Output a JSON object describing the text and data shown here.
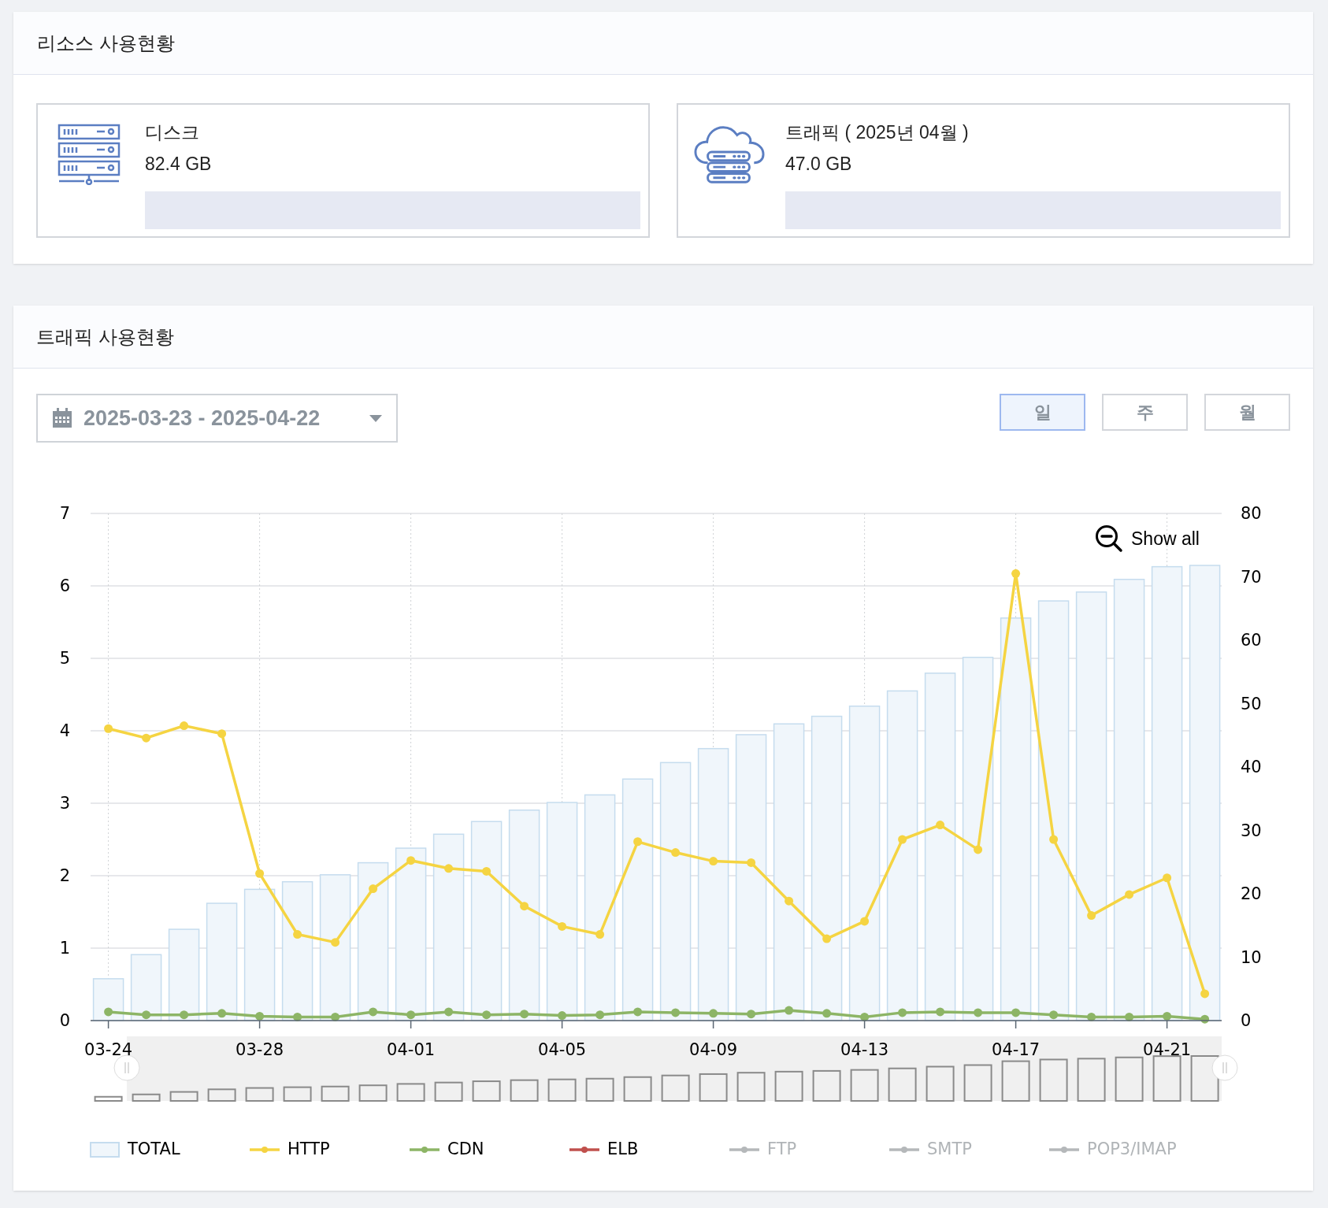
{
  "resources": {
    "title": "리소스 사용현황",
    "cards": [
      {
        "kind": "disk",
        "label": "디스크",
        "value": "82.4 GB",
        "level": 0
      },
      {
        "kind": "traffic",
        "label": "트래픽 ( 2025년 04월 )",
        "value": "47.0 GB",
        "level": 0
      }
    ]
  },
  "traffic": {
    "title": "트래픽 사용현황",
    "date_range": "2025-03-23 - 2025-04-22",
    "periods": [
      {
        "label": "일",
        "selected": true
      },
      {
        "label": "주",
        "selected": false
      },
      {
        "label": "월",
        "selected": false
      }
    ],
    "show_all": "Show all",
    "chart_data": {
      "type": "bar",
      "categories": [
        "03-24",
        null,
        null,
        null,
        "03-28",
        null,
        null,
        null,
        "04-01",
        null,
        null,
        null,
        "04-05",
        null,
        null,
        null,
        "04-09",
        null,
        null,
        null,
        "04-13",
        null,
        null,
        null,
        "04-17",
        null,
        null,
        null,
        "04-21",
        null
      ],
      "series": [
        {
          "name": "TOTAL",
          "type": "bar",
          "axis": "y2",
          "color": "#c5dcee",
          "values": [
            6.6,
            10.4,
            14.4,
            18.5,
            20.7,
            21.9,
            23.0,
            24.9,
            27.2,
            29.4,
            31.4,
            33.2,
            34.4,
            35.6,
            38.1,
            40.7,
            42.9,
            45.1,
            46.8,
            48.0,
            49.6,
            52.0,
            54.8,
            57.3,
            63.5,
            66.2,
            67.6,
            69.6,
            71.6,
            71.8
          ]
        },
        {
          "name": "HTTP",
          "type": "line",
          "marker": true,
          "color": "#f5d442",
          "values": [
            4.03,
            3.9,
            4.07,
            3.96,
            2.03,
            1.19,
            1.08,
            1.82,
            2.21,
            2.1,
            2.06,
            1.58,
            1.3,
            1.19,
            2.47,
            2.32,
            2.2,
            2.18,
            1.65,
            1.13,
            1.37,
            2.5,
            2.7,
            2.36,
            6.17,
            2.5,
            1.45,
            1.74,
            1.97,
            0.37
          ]
        },
        {
          "name": "CDN",
          "type": "line",
          "marker": true,
          "color": "#8db566",
          "values": [
            0.12,
            0.08,
            0.08,
            0.1,
            0.06,
            0.05,
            0.05,
            0.12,
            0.08,
            0.12,
            0.08,
            0.09,
            0.07,
            0.08,
            0.12,
            0.11,
            0.1,
            0.09,
            0.14,
            0.1,
            0.05,
            0.11,
            0.12,
            0.11,
            0.11,
            0.08,
            0.05,
            0.05,
            0.06,
            0.02
          ]
        }
      ],
      "grid": true,
      "ylim": [
        0,
        7
      ],
      "yticks": [
        0,
        1,
        2,
        3,
        4,
        5,
        6,
        7
      ],
      "y2lim": [
        0,
        80
      ],
      "y2ticks": [
        0,
        10,
        20,
        30,
        40,
        50,
        60,
        70,
        80
      ]
    },
    "other_legend": [
      {
        "label": "ELB",
        "kind": "line",
        "color": "#c0504d",
        "visible": true
      },
      {
        "label": "FTP",
        "kind": "line",
        "color": "#b5b8ba",
        "visible": false
      },
      {
        "label": "SMTP",
        "kind": "line",
        "color": "#b5b8ba",
        "visible": false
      },
      {
        "label": "POP3/IMAP",
        "kind": "line",
        "color": "#b5b8ba",
        "visible": false
      }
    ]
  }
}
